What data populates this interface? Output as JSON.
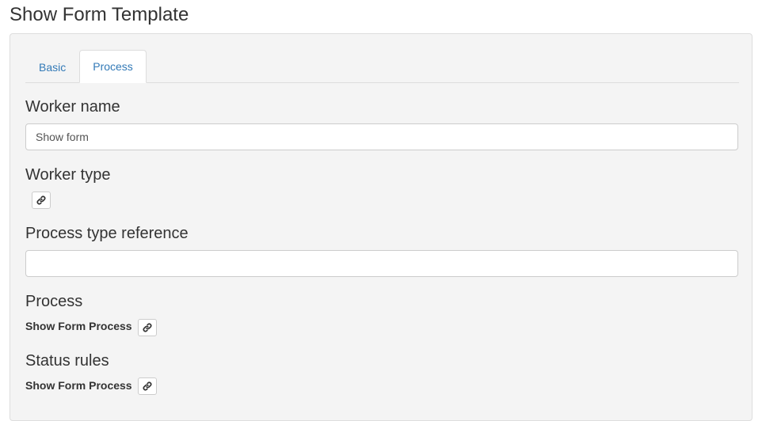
{
  "page": {
    "title": "Show Form Template"
  },
  "tabs": [
    {
      "label": "Basic",
      "active": false
    },
    {
      "label": "Process",
      "active": true
    }
  ],
  "fields": {
    "worker_name": {
      "label": "Worker name",
      "value": "Show form"
    },
    "worker_type": {
      "label": "Worker type",
      "icon": "link-icon"
    },
    "process_type_reference": {
      "label": "Process type reference",
      "value": ""
    },
    "process": {
      "label": "Process",
      "value": "Show Form Process",
      "icon": "link-icon"
    },
    "status_rules": {
      "label": "Status rules",
      "value": "Show Form Process",
      "icon": "link-icon"
    }
  },
  "colors": {
    "link": "#337ab7",
    "panel_bg": "#f4f4f4",
    "border": "#dddddd"
  }
}
